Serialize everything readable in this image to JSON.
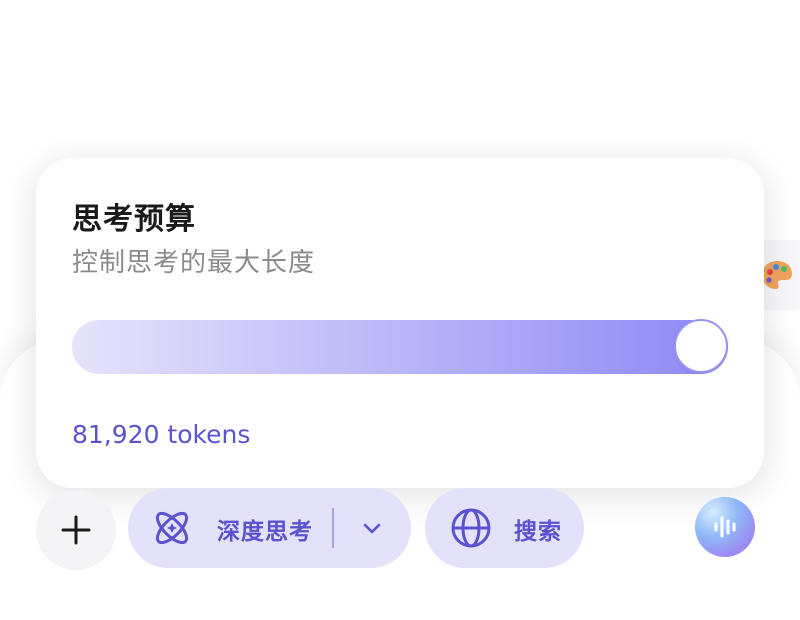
{
  "popover": {
    "title": "思考预算",
    "subtitle": "控制思考的最大长度",
    "slider_fraction": 1.0,
    "value_label": "81,920 tokens"
  },
  "toolbar": {
    "deep_think_label": "深度思考",
    "search_label": "搜索"
  },
  "icons": {
    "add": "plus-icon",
    "deep_think": "atom-icon",
    "dropdown": "chevron-down-icon",
    "search": "globe-icon",
    "voice": "voice-wave-icon",
    "side": "palette-icon"
  },
  "colors": {
    "accent": "#5b52cf",
    "pill_bg": "#e4e2fb",
    "slider_start": "#e6e3fb",
    "slider_end": "#8c88f5"
  }
}
